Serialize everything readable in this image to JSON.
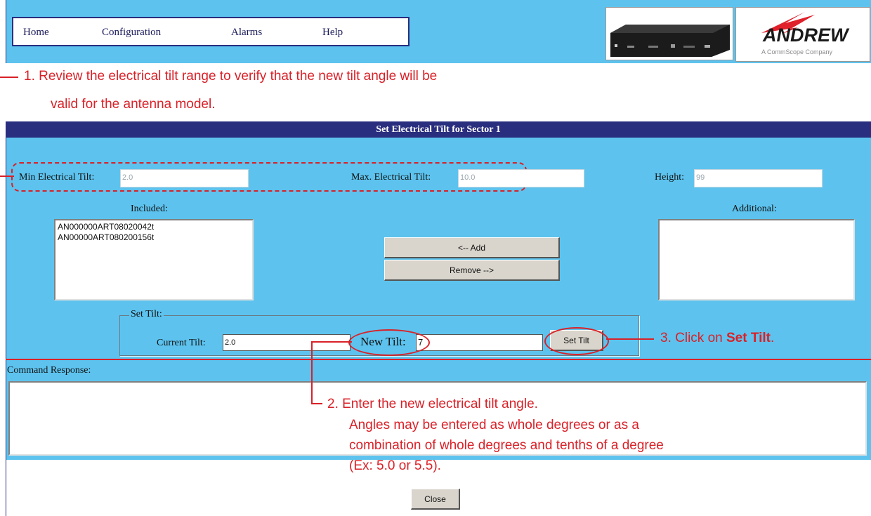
{
  "nav": {
    "items": [
      "Home",
      "Configuration",
      "Alarms",
      "Help"
    ]
  },
  "logo": {
    "brand": "ANDREW",
    "tagline": "A CommScope Company"
  },
  "annotations": {
    "step1_line1": "1. Review the electrical tilt range to verify that the new tilt angle will be",
    "step1_line2": "valid for the antenna model.",
    "step2_lines": [
      "2.  Enter the new electrical tilt angle.",
      "Angles may be entered as whole degrees or as a",
      "combination of whole degrees and tenths of a degree",
      "(Ex: 5.0 or 5.5)."
    ],
    "step3_prefix": "3. Click on ",
    "step3_bold": "Set Tilt",
    "step3_suffix": "."
  },
  "page_title": "Set Electrical Tilt for Sector 1",
  "fields": {
    "min_label": "Min Electrical Tilt:",
    "min_value": "2.0",
    "max_label": "Max. Electrical Tilt:",
    "max_value": "10.0",
    "height_label": "Height:",
    "height_value": "99"
  },
  "included": {
    "label": "Included:",
    "items": [
      "AN000000ART08020042t",
      "AN00000ART080200156t"
    ]
  },
  "additional": {
    "label": "Additional:",
    "items": []
  },
  "buttons": {
    "add": "<-- Add",
    "remove": "Remove -->",
    "set_tilt": "Set Tilt",
    "close": "Close"
  },
  "set_tilt": {
    "legend": "Set Tilt:",
    "current_label": "Current Tilt:",
    "current_value": "2.0",
    "new_label": "New Tilt:",
    "new_value": "7"
  },
  "command_response": {
    "label": "Command Response:",
    "value": ""
  },
  "colors": {
    "panel_blue": "#5dc3ee",
    "header_navy": "#2a2e7e",
    "annotation_red": "#d92128"
  }
}
